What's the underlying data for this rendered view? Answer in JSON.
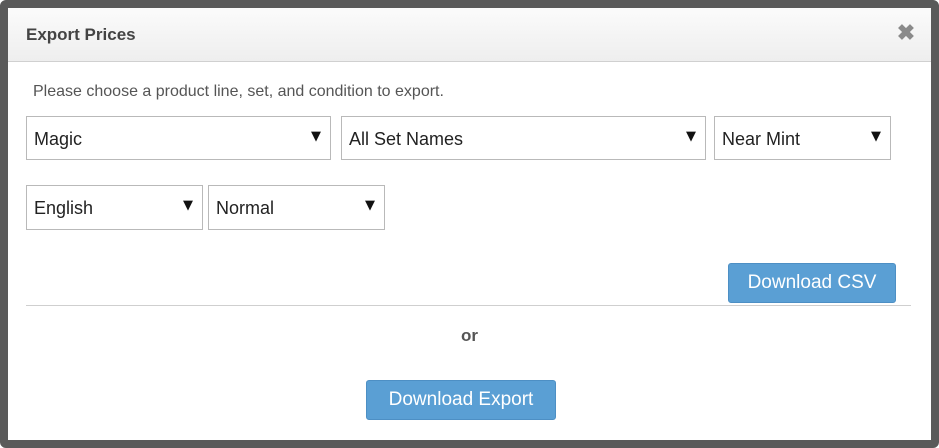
{
  "modal": {
    "title": "Export Prices",
    "close_icon": "close-icon",
    "instructions": "Please choose a product line, set, and condition to export."
  },
  "selects": {
    "product_line": "Magic",
    "set_name": "All Set Names",
    "condition": "Near Mint",
    "language": "English",
    "printing": "Normal",
    "arrow_glyph": "▼"
  },
  "buttons": {
    "download_csv": "Download CSV",
    "or_label": "or",
    "download_export": "Download Export"
  },
  "colors": {
    "button": "#5a9fd4",
    "frame": "#5a5a5a"
  }
}
